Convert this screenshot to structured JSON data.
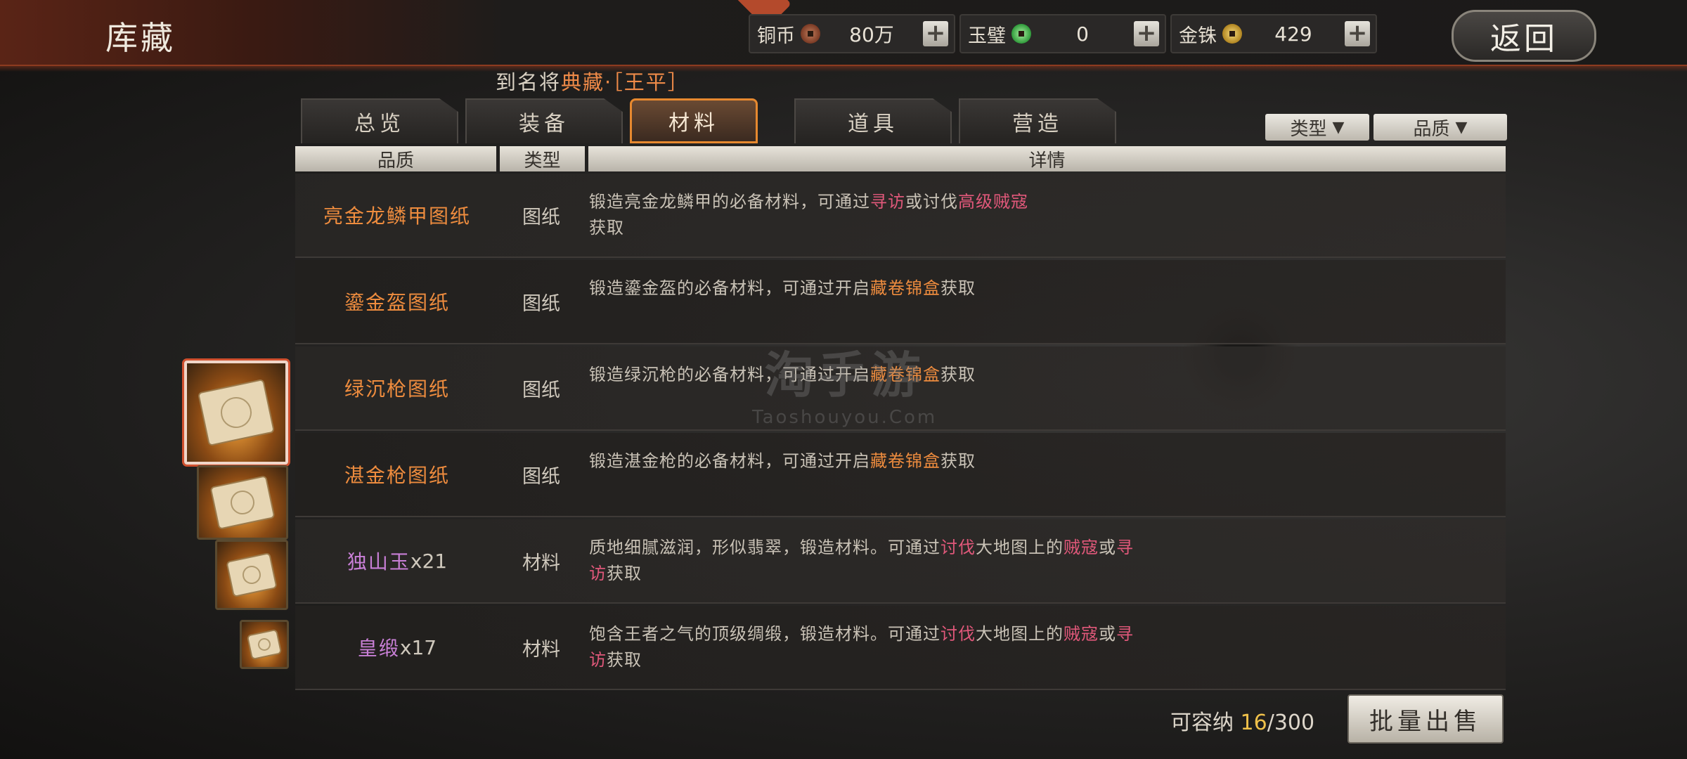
{
  "header": {
    "title": "库藏",
    "back_label": "返回",
    "currencies": [
      {
        "name": "铜币",
        "value": "80万",
        "icon": "copper-coin-icon"
      },
      {
        "name": "玉璧",
        "value": "0",
        "icon": "jade-disc-icon"
      },
      {
        "name": "金铢",
        "value": "429",
        "icon": "gold-coin-icon"
      }
    ],
    "plus_label": "+"
  },
  "hero_line": {
    "prefix": "到名将",
    "name": "典藏",
    "suffix": "·［王平］"
  },
  "tabs": [
    {
      "label": "总览"
    },
    {
      "label": "装备"
    },
    {
      "label": "材料",
      "active": true
    },
    {
      "label": "道具"
    },
    {
      "label": "营造"
    }
  ],
  "filters": {
    "type": "类型",
    "quality": "品质",
    "arrow": "▼"
  },
  "columns": {
    "quality": "品质",
    "type": "类型",
    "detail": "详情"
  },
  "rows": [
    {
      "name": "亮金龙鳞甲图纸",
      "count": "",
      "type": "图纸",
      "name_color": "orange",
      "detail": [
        {
          "t": "锻造亮金龙鳞甲的必备材料，可通过"
        },
        {
          "t": "寻访",
          "hl": true
        },
        {
          "t": "或讨伐"
        },
        {
          "t": "高级贼寇",
          "hl": true
        },
        {
          "t": "获取"
        }
      ]
    },
    {
      "name": "鎏金盔图纸",
      "count": "",
      "type": "图纸",
      "name_color": "orange",
      "detail": [
        {
          "t": "锻造鎏金盔的必备材料，可通过开启"
        },
        {
          "t": "藏卷锦盒",
          "or": true
        },
        {
          "t": "获取"
        }
      ]
    },
    {
      "name": "绿沉枪图纸",
      "count": "",
      "type": "图纸",
      "name_color": "orange",
      "detail": [
        {
          "t": "锻造绿沉枪的必备材料，可通过开启"
        },
        {
          "t": "藏卷锦盒",
          "or": true
        },
        {
          "t": "获取"
        }
      ]
    },
    {
      "name": "湛金枪图纸",
      "count": "",
      "type": "图纸",
      "name_color": "orange",
      "detail": [
        {
          "t": "锻造湛金枪的必备材料，可通过开启"
        },
        {
          "t": "藏卷锦盒",
          "or": true
        },
        {
          "t": "获取"
        }
      ]
    },
    {
      "name": "独山玉",
      "count": "x21",
      "type": "材料",
      "name_color": "purple",
      "detail": [
        {
          "t": "质地细腻滋润，形似翡翠，锻造材料。可通过"
        },
        {
          "t": "讨伐",
          "hl": true
        },
        {
          "t": "大地图上的"
        },
        {
          "t": "贼寇",
          "hl": true
        },
        {
          "t": "或"
        },
        {
          "t": "寻访",
          "hl": true
        },
        {
          "t": "获取"
        }
      ]
    },
    {
      "name": "皇缎",
      "count": "x17",
      "type": "材料",
      "name_color": "purple",
      "detail": [
        {
          "t": "饱含王者之气的顶级绸缎，锻造材料。可通过"
        },
        {
          "t": "讨伐",
          "hl": true
        },
        {
          "t": "大地图上的"
        },
        {
          "t": "贼寇",
          "hl": true
        },
        {
          "t": "或"
        },
        {
          "t": "寻访",
          "hl": true
        },
        {
          "t": "获取"
        }
      ]
    }
  ],
  "footer": {
    "capacity_label": "可容纳",
    "current": "16",
    "max": "/300",
    "sell_label": "批量出售"
  },
  "watermark": {
    "line1": "淘手游",
    "line2": "Taoshouyou.Com"
  }
}
